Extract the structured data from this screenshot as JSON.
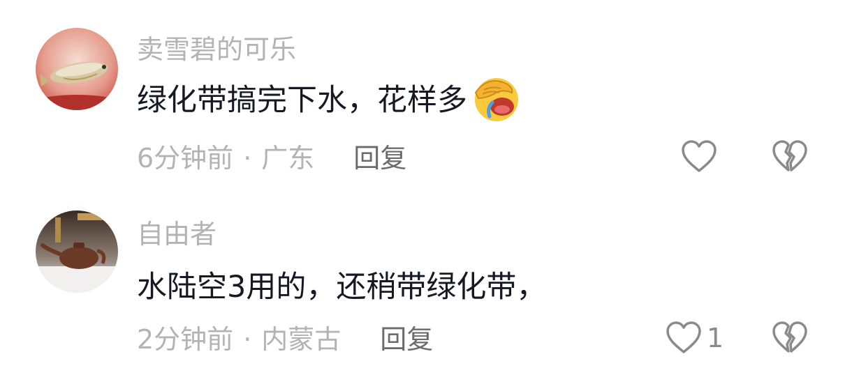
{
  "comments": [
    {
      "username": "卖雪碧的可乐",
      "text": "绿化带搞完下水，花样多",
      "emoji": "face-palm-laughing-emoji",
      "time": "6分钟前",
      "separator": "·",
      "location": "广东",
      "reply_label": "回复",
      "like_count": "",
      "avatar": "fish-avatar"
    },
    {
      "username": "自由者",
      "text": "水陆空3用的，还稍带绿化带，",
      "time": "2分钟前",
      "separator": "·",
      "location": "内蒙古",
      "reply_label": "回复",
      "like_count": "1",
      "avatar": "teapot-avatar"
    }
  ],
  "icons": {
    "like": "heart-outline-icon",
    "dislike": "broken-heart-icon"
  },
  "colors": {
    "username": "#b3b3b3",
    "text": "#161823",
    "meta": "#b3b3b3",
    "reply": "#6b6b6b",
    "icon": "#8a8a8a"
  }
}
